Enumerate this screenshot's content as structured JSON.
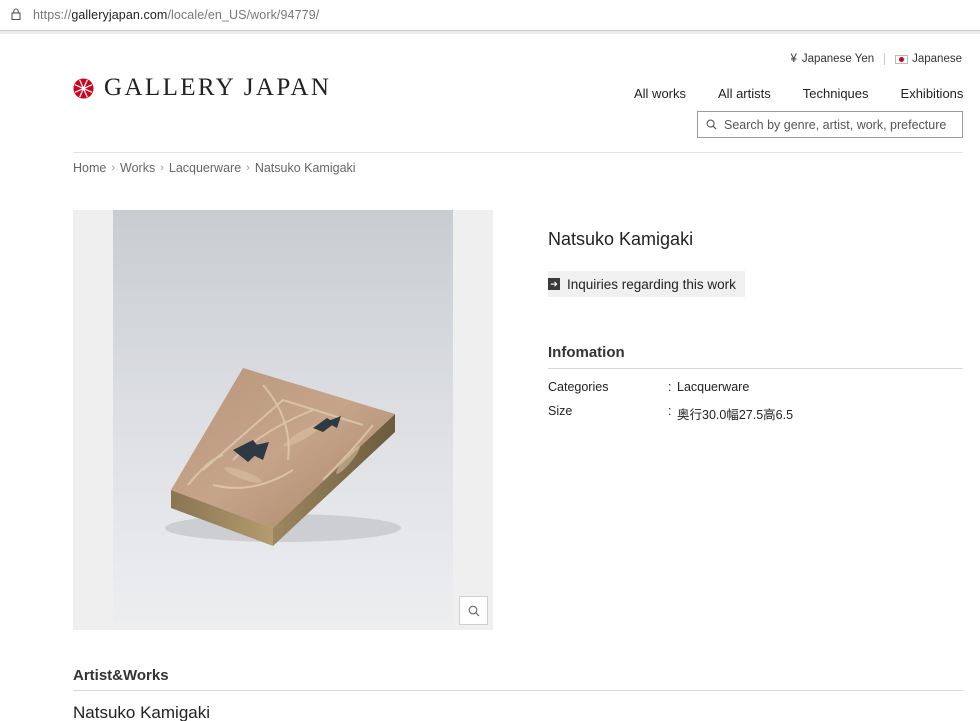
{
  "browser": {
    "url_scheme": "https://",
    "url_domain": "galleryjapan.com",
    "url_path": "/locale/en_US/work/94779/"
  },
  "header": {
    "logo_text": "GALLERY JAPAN",
    "currency_symbol": "¥",
    "currency_label": "Japanese Yen",
    "language_label": "Japanese",
    "nav": [
      "All works",
      "All artists",
      "Techniques",
      "Exhibitions"
    ],
    "search_placeholder": "Search by genre, artist, work, prefecture"
  },
  "breadcrumb": [
    "Home",
    "Works",
    "Lacquerware",
    "Natsuko Kamigaki"
  ],
  "work": {
    "title": "Natsuko Kamigaki",
    "inquiry_label": "Inquiries regarding this work",
    "info_heading": "Infomation",
    "info": [
      {
        "key": "Categories",
        "value": "Lacquerware"
      },
      {
        "key": "Size",
        "value": "奥行30.0幅27.5高6.5"
      }
    ]
  },
  "artist_works": {
    "heading": "Artist&Works",
    "artist_name": "Natsuko Kamigaki"
  },
  "colors": {
    "logo_red": "#d0021b",
    "text": "#222222"
  },
  "icons": [
    "lock-icon",
    "gallery-japan-logo-mark",
    "search-icon",
    "japan-flag-icon",
    "arrow-right-icon",
    "zoom-icon",
    "chevron-right-icon"
  ]
}
